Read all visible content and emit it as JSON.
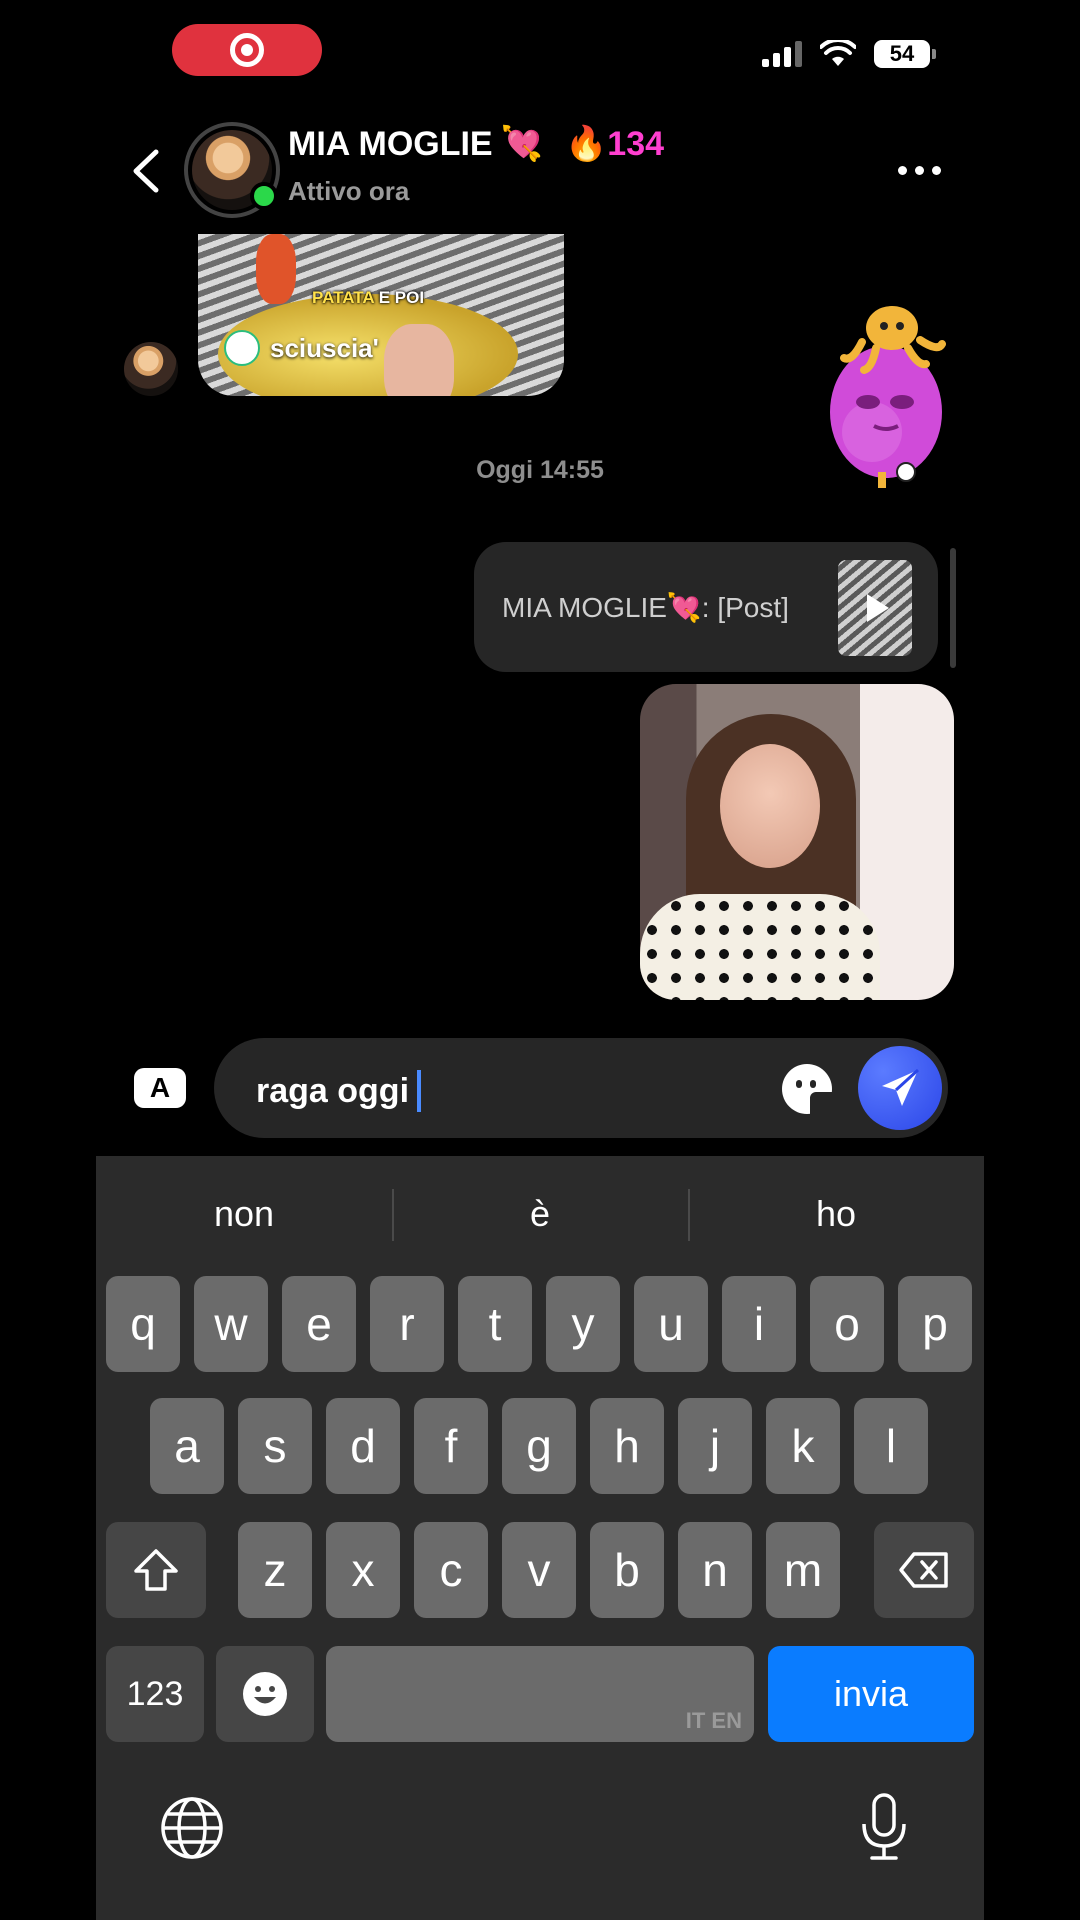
{
  "status_bar": {
    "battery": "54"
  },
  "header": {
    "name": "MIA MOGLIE",
    "name_emoji": "💘",
    "streak": "🔥134",
    "status": "Attivo ora"
  },
  "messages": {
    "video_caption_a": "PATATA",
    "video_caption_b": "E POI",
    "video_username": "sciuscia'",
    "timestamp": "Oggi 14:55",
    "reply_text": "MIA MOGLIE💘: [Post]"
  },
  "composer": {
    "text": "raga oggi",
    "a_label": "A"
  },
  "keyboard": {
    "suggestions": [
      "non",
      "è",
      "ho"
    ],
    "row1": [
      "q",
      "w",
      "e",
      "r",
      "t",
      "y",
      "u",
      "i",
      "o",
      "p"
    ],
    "row2": [
      "a",
      "s",
      "d",
      "f",
      "g",
      "h",
      "j",
      "k",
      "l"
    ],
    "row3": [
      "z",
      "x",
      "c",
      "v",
      "b",
      "n",
      "m"
    ],
    "numbers_label": "123",
    "send_label": "invia",
    "space_lang": "IT EN"
  },
  "icons": {
    "back": "chevron-left-icon",
    "more": "more-dots-icon",
    "send": "paper-plane-icon",
    "sticker": "sticker-icon",
    "shift": "shift-icon",
    "delete": "backspace-icon",
    "emoji": "emoji-icon",
    "globe": "globe-icon",
    "mic": "microphone-icon"
  },
  "colors": {
    "accent": "#0a7cff",
    "online": "#2bd84a",
    "streak": "#ff3fd0"
  }
}
